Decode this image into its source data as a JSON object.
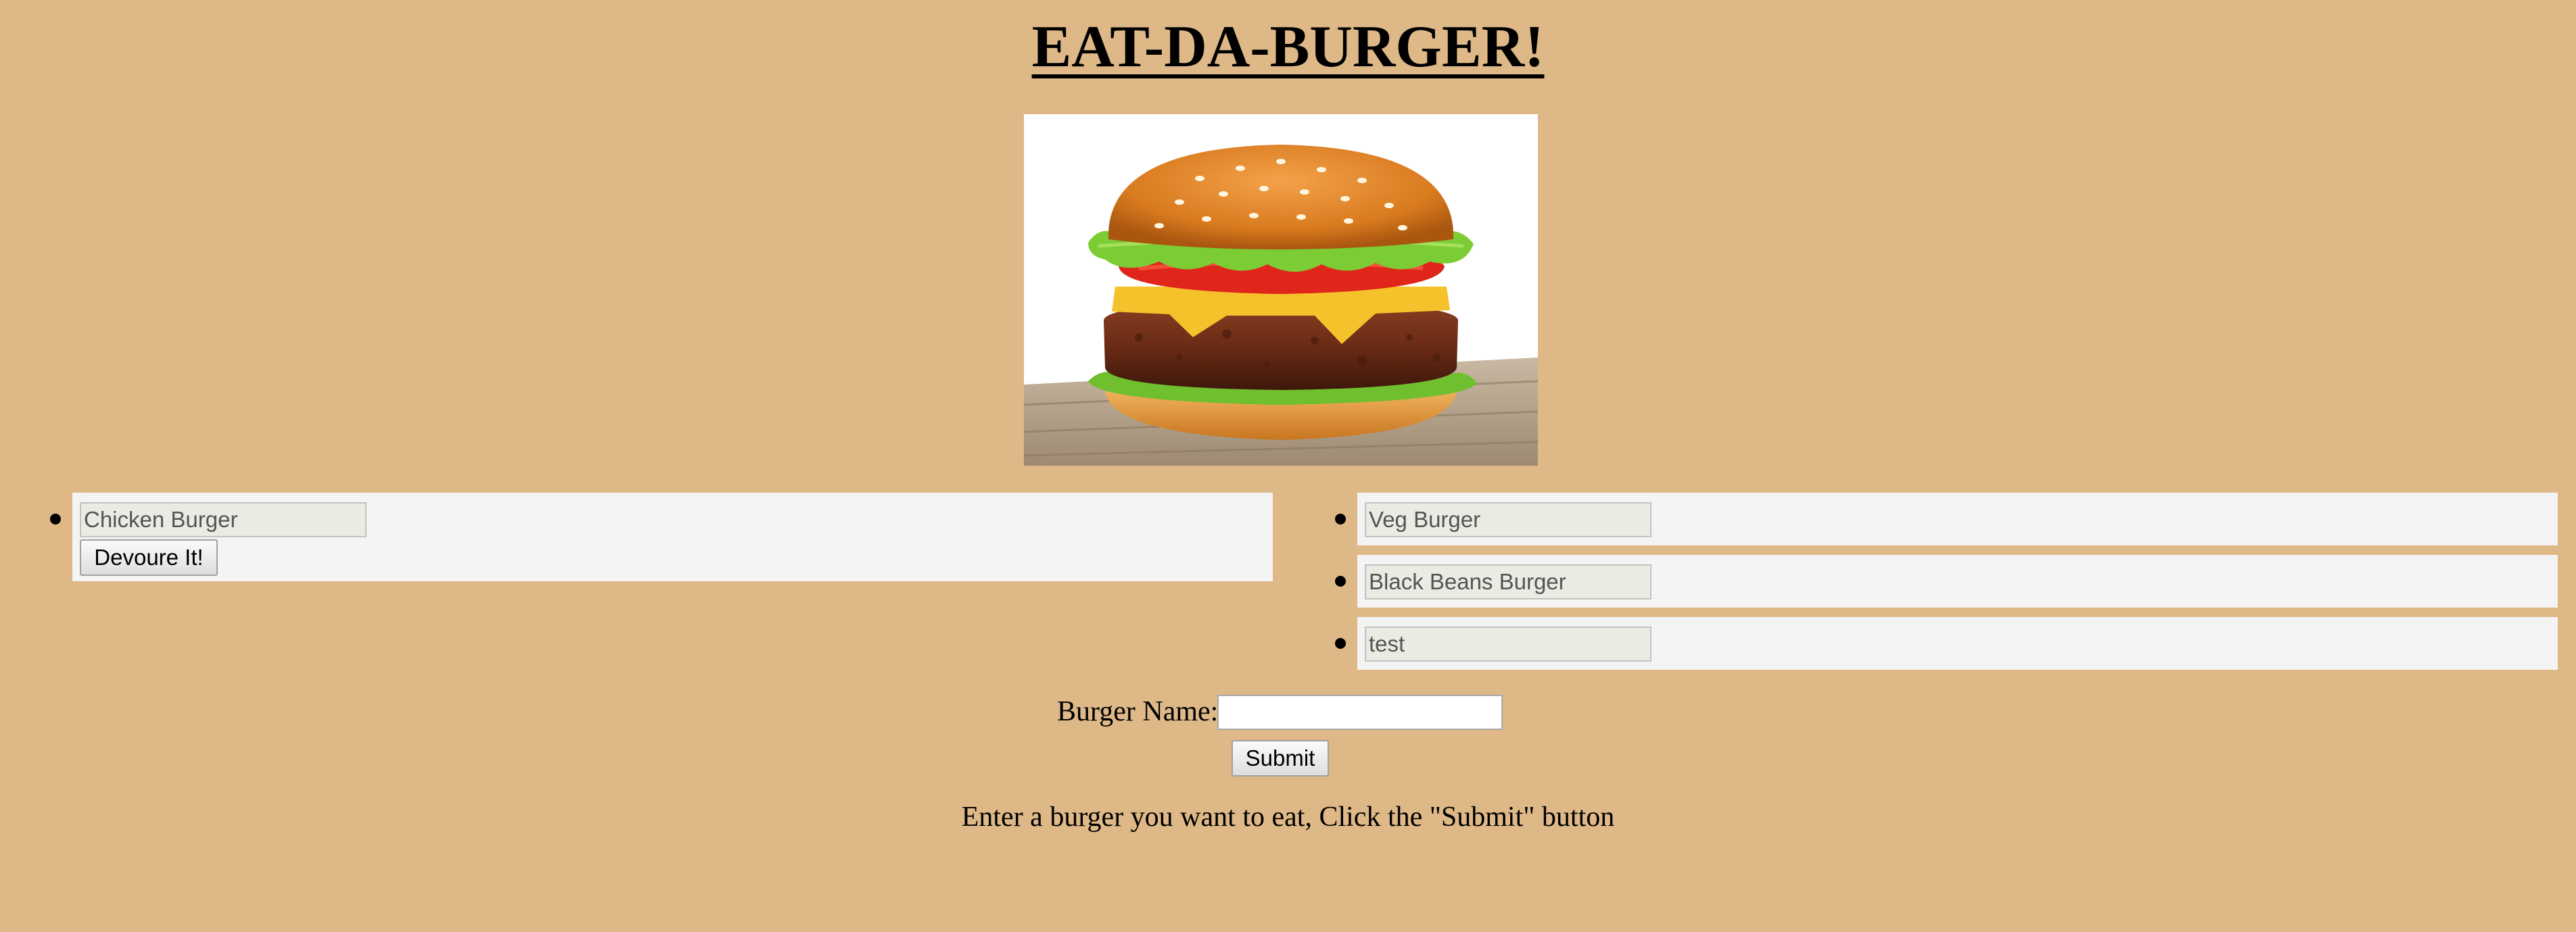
{
  "page": {
    "title": "EAT-DA-BURGER!",
    "background_color": "#deb887",
    "hero_image": "burger-photo"
  },
  "not_devoured": {
    "items": [
      {
        "name": "Chicken Burger",
        "button_label": "Devoure It!"
      }
    ]
  },
  "devoured": {
    "items": [
      {
        "name": "Veg Burger"
      },
      {
        "name": "Black Beans Burger"
      },
      {
        "name": "test"
      }
    ]
  },
  "form": {
    "label": "Burger Name:",
    "input_value": "",
    "submit_label": "Submit"
  },
  "instructions": "Enter a burger you want to eat, Click the \"Submit\" button"
}
